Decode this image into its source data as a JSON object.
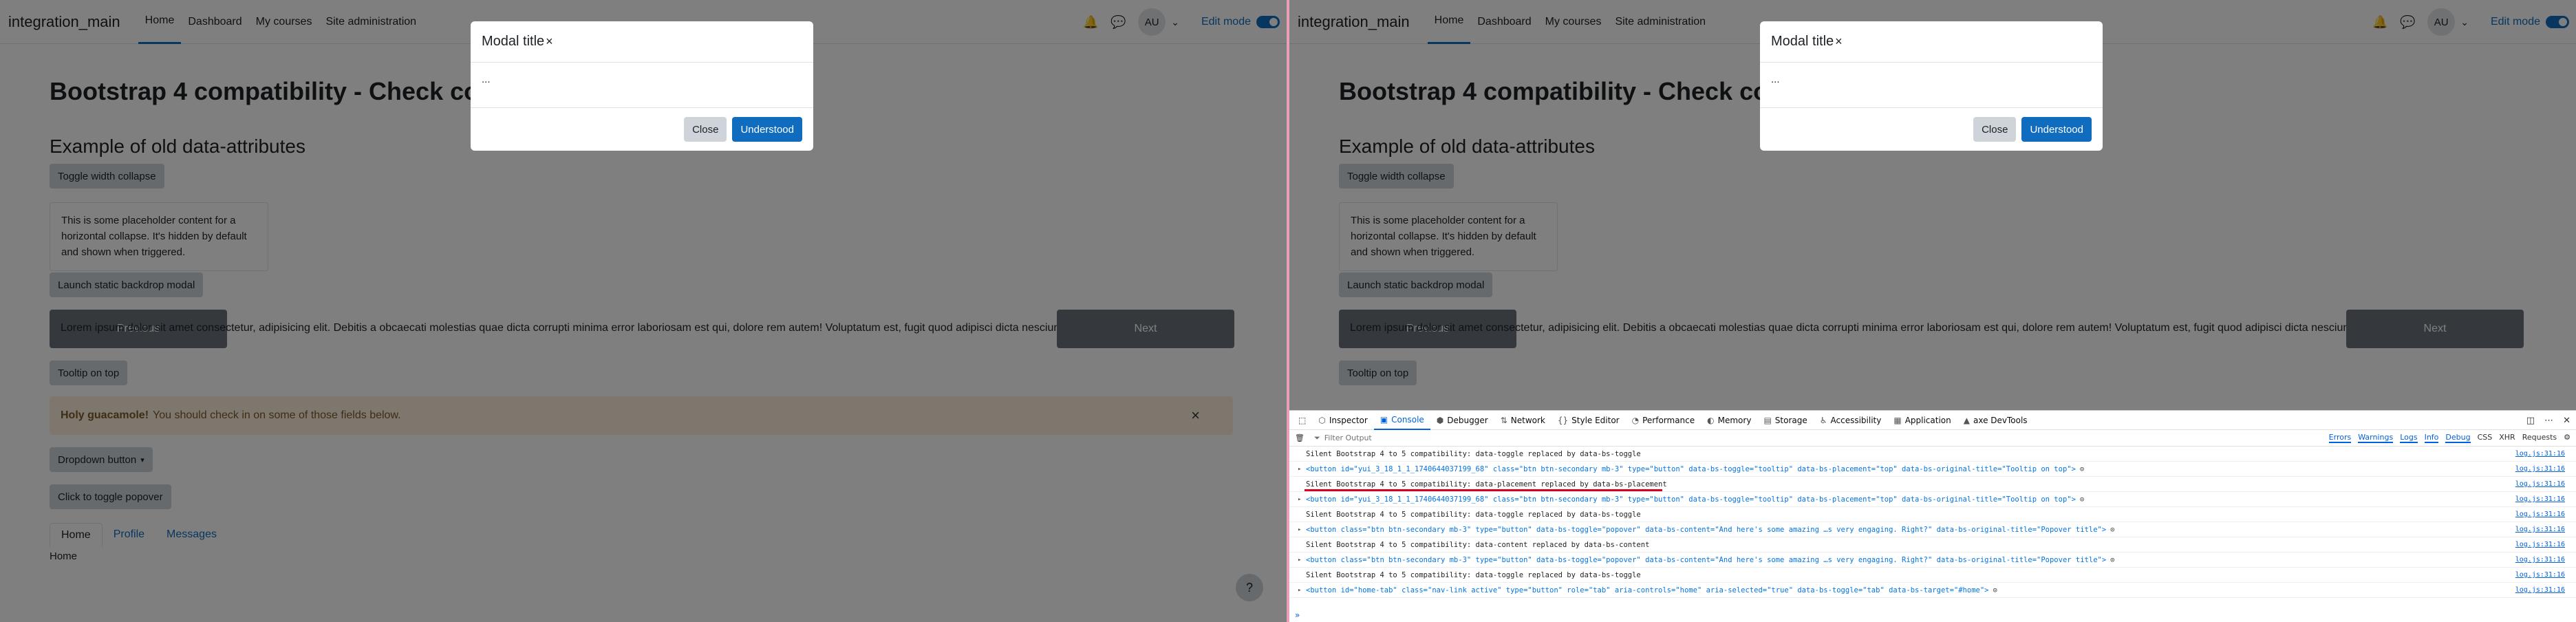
{
  "page": {
    "brand": "integration_main",
    "nav": [
      "Home",
      "Dashboard",
      "My courses",
      "Site administration"
    ],
    "user_initials": "AU",
    "edit_mode_label": "Edit mode",
    "title": "Bootstrap 4 compatibility - Check compatibi",
    "section_heading": "Example of old data-attributes",
    "toggle_width_label": "Toggle width collapse",
    "placeholder_text": "This is some placeholder content for a horizontal collapse. It's hidden by default and shown when triggered.",
    "launch_modal_label": "Launch static backdrop modal",
    "carousel_prev": "Previous",
    "carousel_next": "Next",
    "carousel_text": "Lorem ipsum dolor sit amet consectetur, adipisicing elit. Debitis a obcaecati molestias quae dicta corrupti minima error laboriosam est qui, dolore rem autem! Voluptatum est, fugit quod adipisci dicta nesciunt!",
    "tooltip_label": "Tooltip on top",
    "alert_strong": "Holy guacamole!",
    "alert_text": "You should check in on some of those fields below.",
    "dropdown_label": "Dropdown button",
    "popover_label": "Click to toggle popover",
    "tabs": [
      "Home",
      "Profile",
      "Messages"
    ],
    "tab_content": "Home",
    "help_label": "?"
  },
  "modal": {
    "title": "Modal title",
    "body": "...",
    "close_label": "Close",
    "understood_label": "Understood"
  },
  "devtools": {
    "tabs": [
      {
        "label": "Inspector",
        "icon": "⬡"
      },
      {
        "label": "Console",
        "icon": "▣"
      },
      {
        "label": "Debugger",
        "icon": "⬢"
      },
      {
        "label": "Network",
        "icon": "⇅"
      },
      {
        "label": "Style Editor",
        "icon": "{}"
      },
      {
        "label": "Performance",
        "icon": "◔"
      },
      {
        "label": "Memory",
        "icon": "◐"
      },
      {
        "label": "Storage",
        "icon": "▤"
      },
      {
        "label": "Accessibility",
        "icon": "♿"
      },
      {
        "label": "Application",
        "icon": "▦"
      },
      {
        "label": "axe DevTools",
        "icon": "▲"
      }
    ],
    "filter_placeholder": "Filter Output",
    "filters_on": [
      "Errors",
      "Warnings",
      "Logs",
      "Info",
      "Debug"
    ],
    "filters_off": [
      "CSS",
      "XHR",
      "Requests"
    ],
    "source": "log.js:31:16",
    "logs": [
      {
        "kind": "text",
        "text": "Silent Bootstrap 4 to 5 compatibility: data-toggle replaced by data-bs-toggle"
      },
      {
        "kind": "el",
        "text": "<button id=\"yui_3_18_1_1_1740644037199_68\" class=\"btn btn-secondary mb-3\" type=\"button\" data-bs-toggle=\"tooltip\" data-bs-placement=\"top\" data-bs-original-title=\"Tooltip on top\">"
      },
      {
        "kind": "text",
        "text": "Silent Bootstrap 4 to 5 compatibility: data-placement replaced by data-bs-placement",
        "underline": true
      },
      {
        "kind": "el",
        "text": "<button id=\"yui_3_18_1_1_1740644037199_68\" class=\"btn btn-secondary mb-3\" type=\"button\" data-bs-toggle=\"tooltip\" data-bs-placement=\"top\" data-bs-original-title=\"Tooltip on top\">"
      },
      {
        "kind": "text",
        "text": "Silent Bootstrap 4 to 5 compatibility: data-toggle replaced by data-bs-toggle"
      },
      {
        "kind": "el",
        "text": "<button class=\"btn btn-secondary mb-3\" type=\"button\" data-bs-toggle=\"popover\" data-bs-content=\"And here's some amazing …s very engaging. Right?\" data-bs-original-title=\"Popover title\">"
      },
      {
        "kind": "text",
        "text": "Silent Bootstrap 4 to 5 compatibility: data-content replaced by data-bs-content"
      },
      {
        "kind": "el",
        "text": "<button class=\"btn btn-secondary mb-3\" type=\"button\" data-bs-toggle=\"popover\" data-bs-content=\"And here's some amazing …s very engaging. Right?\" data-bs-original-title=\"Popover title\">"
      },
      {
        "kind": "text",
        "text": "Silent Bootstrap 4 to 5 compatibility: data-toggle replaced by data-bs-toggle"
      },
      {
        "kind": "el",
        "text": "<button id=\"home-tab\" class=\"nav-link active\" type=\"button\" role=\"tab\" aria-controls=\"home\" aria-selected=\"true\" data-bs-toggle=\"tab\" data-bs-target=\"#home\">"
      }
    ],
    "prompt": "»"
  },
  "colors": {
    "primary": "#0f6cbf",
    "secondary": "#ced4da",
    "alert_bg": "#fcefdc",
    "devtools_accent": "#0060df",
    "error_underline": "#d70022"
  }
}
